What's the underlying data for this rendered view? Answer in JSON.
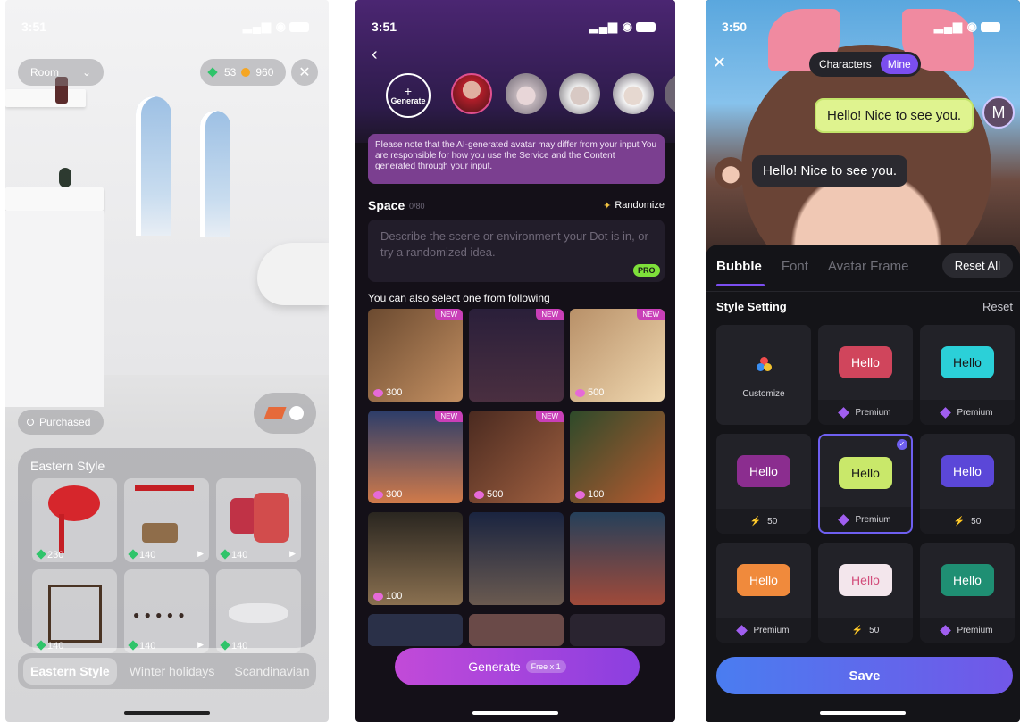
{
  "screen1": {
    "status_time": "3:51",
    "room_select": "Room",
    "gems": "53",
    "coins": "960",
    "purchased_label": "Purchased",
    "section_title": "Eastern Style",
    "items": [
      {
        "price": "230"
      },
      {
        "price": "140"
      },
      {
        "price": "140"
      },
      {
        "price": "140"
      },
      {
        "price": "140"
      },
      {
        "price": "140"
      }
    ],
    "tabs": [
      "Eastern Style",
      "Winter holidays",
      "Scandinavian"
    ]
  },
  "screen2": {
    "status_time": "3:51",
    "generate_label": "Generate",
    "notice": "Please note that the AI-generated avatar may differ from your input You are responsible for how you use the Service and the Content generated through your input.",
    "space_label": "Space",
    "space_count": "0/80",
    "randomize_label": "Randomize",
    "placeholder": "Describe the scene or environment your Dot is in, or try a randomized idea.",
    "pro_badge": "PRO",
    "select_hint": "You can also select one from following",
    "new_tag": "NEW",
    "scenes": [
      {
        "price": "300",
        "new": true
      },
      {
        "price": "",
        "new": true
      },
      {
        "price": "500",
        "new": true
      },
      {
        "price": "300",
        "new": true
      },
      {
        "price": "500",
        "new": true
      },
      {
        "price": "100",
        "new": false
      },
      {
        "price": "100",
        "new": false
      },
      {
        "price": "",
        "new": false
      },
      {
        "price": "",
        "new": false
      }
    ],
    "generate_button": "Generate",
    "free_badge": "Free x 1"
  },
  "screen3": {
    "status_time": "3:50",
    "toggle": [
      "Characters",
      "Mine"
    ],
    "bubble_user": "Hello! Nice to see you.",
    "bubble_char": "Hello! Nice to see you.",
    "user_initial": "M",
    "tabs": [
      "Bubble",
      "Font",
      "Avatar Frame"
    ],
    "reset_all": "Reset All",
    "style_setting": "Style Setting",
    "reset": "Reset",
    "customize": "Customize",
    "hello": "Hello",
    "cards": [
      {
        "price": "Premium",
        "kind": "premium",
        "color": "#d0455c"
      },
      {
        "price": "Premium",
        "kind": "premium",
        "color": "#2bd0d8"
      },
      {
        "price": "50",
        "kind": "bolt",
        "color": "#8b2d8f"
      },
      {
        "price": "Premium",
        "kind": "premium",
        "color": "#c9e86a"
      },
      {
        "price": "50",
        "kind": "bolt",
        "color": "#5b47d8"
      },
      {
        "price": "Premium",
        "kind": "premium",
        "color": "#f08a3c"
      },
      {
        "price": "50",
        "kind": "bolt",
        "color": "#f3e6ec"
      },
      {
        "price": "Premium",
        "kind": "premium",
        "color": "#1f8f73"
      }
    ],
    "save": "Save"
  }
}
